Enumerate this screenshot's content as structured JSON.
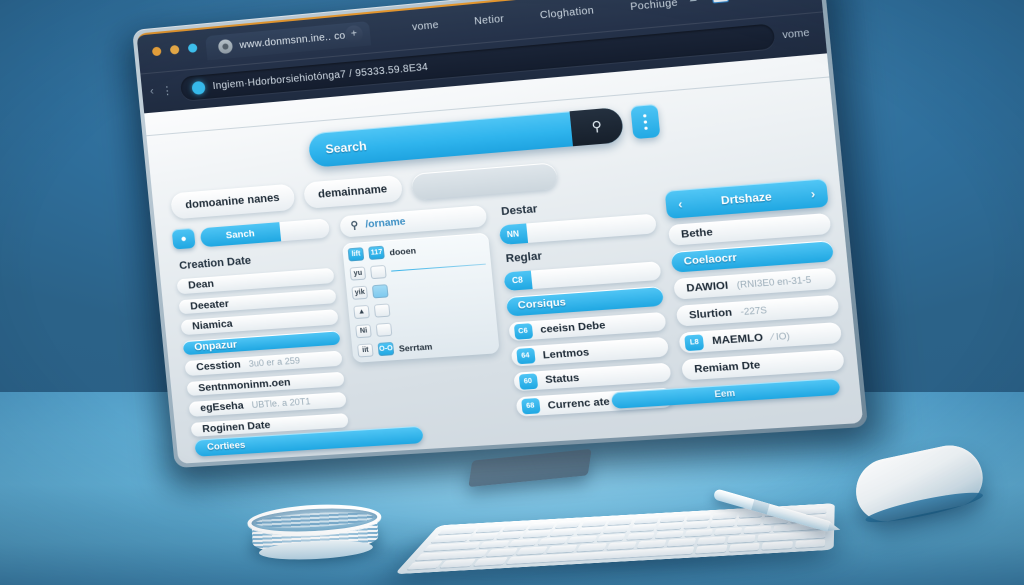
{
  "scene": {
    "description": "3D illustration of a desktop monitor showing a domain-name search web app, with keyboard, mouse, stylus pen and mesh basket on a blue desk",
    "background_color": "#2f6f9c",
    "desk_color": "#62b0d6",
    "accent_color": "#2fb4ed",
    "dark_chrome_color": "#25324a",
    "chrome_top_stripe_color": "#e2962f"
  },
  "browser": {
    "window_dots": [
      "orange",
      "orange",
      "cyan"
    ],
    "tab": {
      "favicon": "lock-icon",
      "title": "www.donmsnn.ine.. com."
    },
    "new_tab_label": "+",
    "nav_items": [
      "vome",
      "Netior",
      "Cloghation",
      "Pochiuge"
    ],
    "toolbar_icons": [
      "home-icon",
      "extension-icon",
      "reading-list-icon",
      "more-icon",
      "profile-icon"
    ],
    "back_label": "‹",
    "menu_label": "⋮",
    "address": {
      "ssl_indicator": "secure-dot",
      "url": "Ingiem·Hdorborsiehiotónga7 / 95333.59.8E34",
      "right_label": "vome"
    }
  },
  "page": {
    "hero_search": {
      "placeholder": "Search",
      "go_icon": "magnifier-icon",
      "kebab_icon": "three-dots-icon"
    },
    "pills": [
      {
        "label": "domoanine nanes"
      },
      {
        "label": "demainname"
      },
      {
        "label": ""
      }
    ],
    "left_column": {
      "toolbar": {
        "icon": "person-icon",
        "segment_label": "Sanch"
      },
      "heading": "Creation Date",
      "rows": [
        {
          "label": "Dean",
          "sub": "",
          "selected": false
        },
        {
          "label": "Deeater",
          "sub": "",
          "selected": false
        },
        {
          "label": "Niamica",
          "sub": "",
          "selected": false
        },
        {
          "label": "Onpazur",
          "sub": "",
          "selected": true
        },
        {
          "label": "Cesstion",
          "sub": "3u0 er a 259",
          "selected": false
        },
        {
          "label": "Sentnmoninm.oen",
          "sub": "",
          "selected": false
        },
        {
          "label": "egEseha",
          "sub": "UBTle. a 20T1",
          "selected": false
        },
        {
          "label": "Roginen Date",
          "sub": "",
          "selected": false
        }
      ],
      "footer_label": "Cortiees"
    },
    "mid_column": {
      "find_field": {
        "icon": "magnifier-icon",
        "value": "/orname"
      },
      "card_rows": [
        {
          "key": "lift",
          "badge": "117",
          "label": "dooen",
          "state": "on"
        },
        {
          "key": "yu",
          "badge": "",
          "label": "",
          "state": "off"
        },
        {
          "key": "yik",
          "badge": "",
          "label": "",
          "state": "mid"
        },
        {
          "key": "▲",
          "badge": "",
          "label": "",
          "state": "off"
        },
        {
          "key": "Ni",
          "badge": "",
          "label": "",
          "state": "off"
        },
        {
          "key": "iit",
          "badge": "O-O",
          "label": "Serrtam",
          "state": "off"
        }
      ]
    },
    "center_column": {
      "label_1": "Destar",
      "field_1": {
        "prefix": "NN",
        "value": ""
      },
      "label_2": "Reglar",
      "field_2": {
        "prefix": "C8",
        "value": ""
      },
      "rows": [
        {
          "prefix": "",
          "label": "Corsiqus",
          "selected": true
        },
        {
          "prefix": "C6",
          "label": "ceeisn Debe",
          "selected": false
        },
        {
          "prefix": "64",
          "label": "Lentmos",
          "selected": false
        },
        {
          "prefix": "60",
          "label": "Status",
          "selected": false
        },
        {
          "prefix": "68",
          "label": "Currenc ate",
          "selected": false
        }
      ],
      "footer_label": "Eem"
    },
    "right_column": {
      "pager": {
        "prev_icon": "chevron-left-icon",
        "label": "Drtshaze",
        "next_icon": "chevron-right-icon"
      },
      "rows": [
        {
          "prefix": "",
          "label": "Bethe",
          "sub": "",
          "selected": false
        },
        {
          "prefix": "",
          "label": "Coelaocrr",
          "sub": "",
          "selected": true
        },
        {
          "prefix": "",
          "label": "DAWIOI",
          "sub": "(RNI3E0  en-31-5",
          "selected": false
        },
        {
          "prefix": "",
          "label": "Slurtion",
          "sub": "-227S",
          "selected": false
        },
        {
          "prefix": "L8",
          "label": "MAEMLO",
          "sub": "⁄ IO)",
          "selected": false
        },
        {
          "prefix": "",
          "label": "Remiam Dte",
          "sub": "",
          "selected": false
        }
      ]
    }
  },
  "desk_objects": {
    "keyboard": "white-keyboard",
    "mouse": "white-mouse",
    "pen": "silver-stylus-pen",
    "basket": "mesh-pen-holder-basket"
  }
}
